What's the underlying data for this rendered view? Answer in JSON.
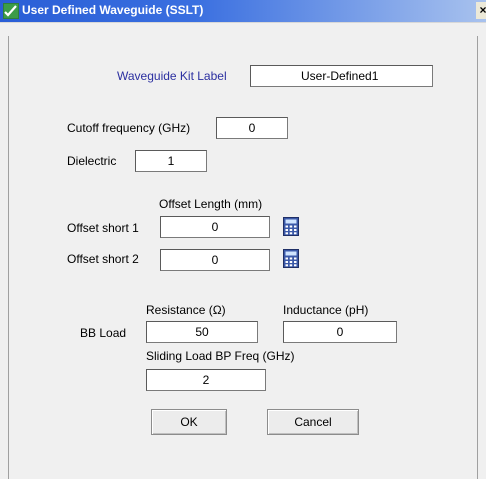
{
  "window": {
    "title": "User Defined Waveguide (SSLT)",
    "close_label": "×"
  },
  "kit": {
    "label": "Waveguide Kit Label",
    "value": "User-Defined1"
  },
  "cutoff": {
    "label": "Cutoff frequency (GHz)",
    "value": "0"
  },
  "dielectric": {
    "label": "Dielectric",
    "value": "1"
  },
  "offset": {
    "header": "Offset Length (mm)",
    "short1_label": "Offset short 1",
    "short1_value": "0",
    "short2_label": "Offset short 2",
    "short2_value": "0",
    "calc_icon": "calculator-icon"
  },
  "bbload": {
    "label": "BB Load",
    "resistance_label": "Resistance (Ω)",
    "resistance_value": "50",
    "inductance_label": "Inductance (pH)",
    "inductance_value": "0",
    "sliding_label": "Sliding Load BP Freq (GHz)",
    "sliding_value": "2"
  },
  "buttons": {
    "ok": "OK",
    "cancel": "Cancel"
  },
  "colors": {
    "title_bar": "#2a5ed6",
    "accent_label": "#2b2fa0",
    "dialog_bg": "#f0f0f0"
  }
}
